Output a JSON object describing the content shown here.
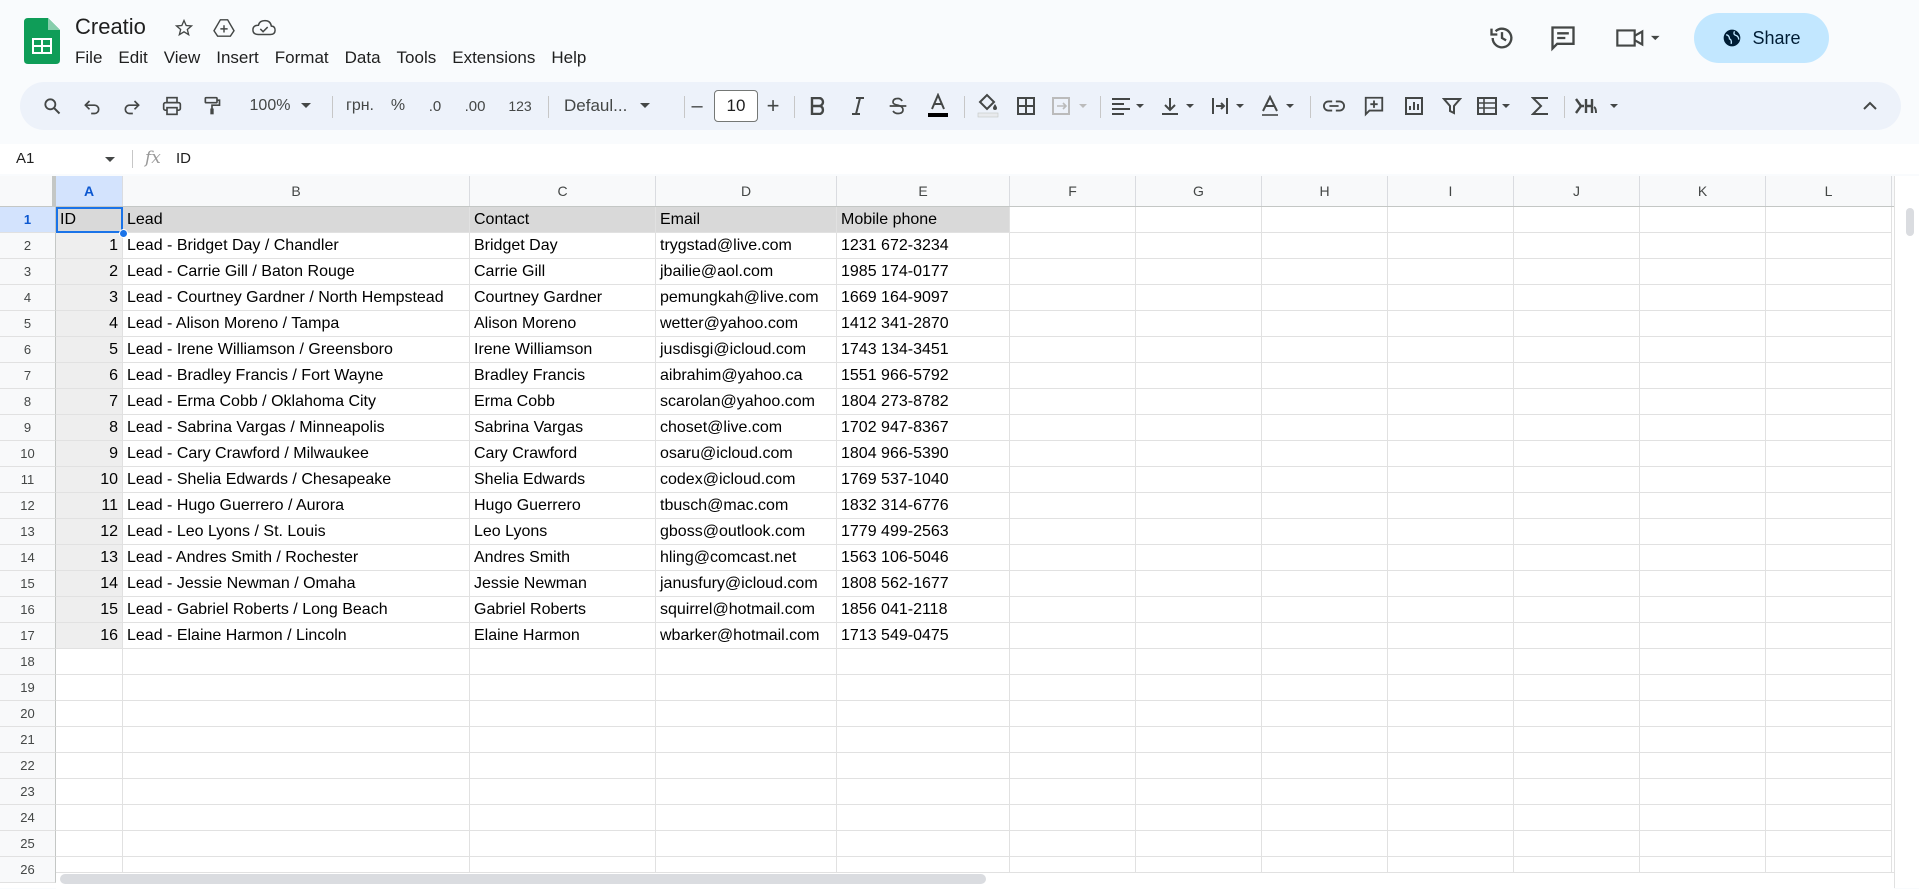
{
  "app": {
    "title": "Creatio",
    "menu": [
      "File",
      "Edit",
      "View",
      "Insert",
      "Format",
      "Data",
      "Tools",
      "Extensions",
      "Help"
    ],
    "share_label": "Share",
    "brand_color": "#0f9d58",
    "share_bg": "#c2e7ff"
  },
  "toolbar": {
    "zoom": "100%",
    "currency": "грн.",
    "percent": "%",
    "dec_decrease": ".0",
    "dec_increase": ".00",
    "number_format": "123",
    "font": "Defaul...",
    "font_size": "10",
    "minus": "–",
    "plus": "+"
  },
  "formula_bar": {
    "name_box": "A1",
    "fx": "fx",
    "value": "ID"
  },
  "columns": [
    "A",
    "B",
    "C",
    "D",
    "E",
    "F",
    "G",
    "H",
    "I",
    "J",
    "K",
    "L"
  ],
  "row_numbers": [
    "1",
    "2",
    "3",
    "4",
    "5",
    "6",
    "7",
    "8",
    "9",
    "10",
    "11",
    "12",
    "13",
    "14",
    "15",
    "16",
    "17",
    "18",
    "19",
    "20",
    "21",
    "22",
    "23",
    "24",
    "25",
    "26"
  ],
  "header_row": [
    "ID",
    "Lead",
    "Contact",
    "Email",
    "Mobile phone"
  ],
  "rows": [
    [
      "1",
      "Lead - Bridget Day / Chandler",
      "Bridget Day",
      "trygstad@live.com",
      "1231 672-3234"
    ],
    [
      "2",
      "Lead - Carrie Gill / Baton Rouge",
      "Carrie Gill",
      "jbailie@aol.com",
      "1985 174-0177"
    ],
    [
      "3",
      "Lead - Courtney Gardner / North Hempstead",
      "Courtney Gardner",
      "pemungkah@live.com",
      "1669 164-9097"
    ],
    [
      "4",
      "Lead - Alison Moreno / Tampa",
      "Alison Moreno",
      "wetter@yahoo.com",
      "1412 341-2870"
    ],
    [
      "5",
      "Lead - Irene Williamson / Greensboro",
      "Irene Williamson",
      "jusdisgi@icloud.com",
      "1743 134-3451"
    ],
    [
      "6",
      "Lead - Bradley Francis / Fort Wayne",
      "Bradley Francis",
      "aibrahim@yahoo.ca",
      "1551 966-5792"
    ],
    [
      "7",
      "Lead - Erma Cobb / Oklahoma City",
      "Erma Cobb",
      "scarolan@yahoo.com",
      "1804 273-8782"
    ],
    [
      "8",
      "Lead - Sabrina Vargas / Minneapolis",
      "Sabrina Vargas",
      "choset@live.com",
      "1702 947-8367"
    ],
    [
      "9",
      "Lead - Cary Crawford / Milwaukee",
      "Cary Crawford",
      "osaru@icloud.com",
      "1804 966-5390"
    ],
    [
      "10",
      "Lead - Shelia Edwards / Chesapeake",
      "Shelia Edwards",
      "codex@icloud.com",
      "1769 537-1040"
    ],
    [
      "11",
      "Lead - Hugo Guerrero / Aurora",
      "Hugo Guerrero",
      "tbusch@mac.com",
      "1832 314-6776"
    ],
    [
      "12",
      "Lead - Leo Lyons / St. Louis",
      "Leo Lyons",
      "gboss@outlook.com",
      "1779 499-2563"
    ],
    [
      "13",
      "Lead - Andres Smith / Rochester",
      "Andres Smith",
      "hling@comcast.net",
      "1563 106-5046"
    ],
    [
      "14",
      "Lead - Jessie Newman / Omaha",
      "Jessie Newman",
      "janusfury@icloud.com",
      "1808 562-1677"
    ],
    [
      "15",
      "Lead - Gabriel Roberts / Long Beach",
      "Gabriel Roberts",
      "squirrel@hotmail.com",
      "1856 041-2118"
    ],
    [
      "16",
      "Lead - Elaine Harmon / Lincoln",
      "Elaine Harmon",
      "wbarker@hotmail.com",
      "1713 549-0475"
    ]
  ]
}
